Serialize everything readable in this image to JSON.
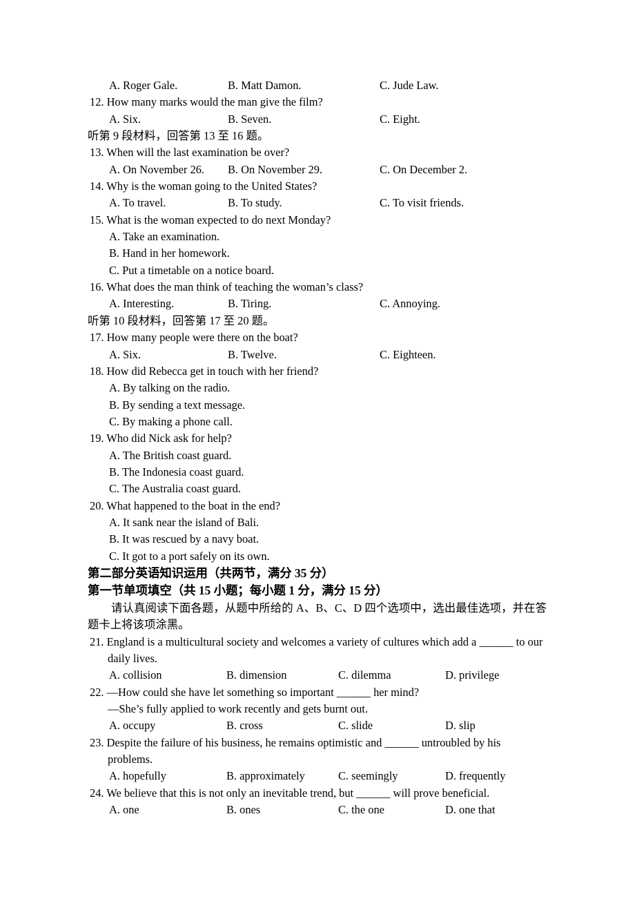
{
  "document": {
    "type": "exam-paper",
    "language": "zh-CN / en",
    "subject": "English"
  },
  "listening": {
    "q11_options": {
      "a": "A. Roger Gale.",
      "b": "B. Matt Damon.",
      "c": "C. Jude Law."
    },
    "q12": {
      "stem": "12. How many marks would the man give the film?",
      "a": "A. Six.",
      "b": "B. Seven.",
      "c": "C. Eight."
    },
    "material9_note": "听第 9 段材料，回答第 13 至 16 题。",
    "q13": {
      "stem": "13. When will the last examination be over?",
      "a": "A. On November 26.",
      "b": "B. On November 29.",
      "c": "C. On December 2."
    },
    "q14": {
      "stem": "14. Why is the woman going to the United States?",
      "a": "A. To travel.",
      "b": "B. To study.",
      "c": "C. To visit friends."
    },
    "q15": {
      "stem": "15. What is the woman expected to do next Monday?",
      "a": "A. Take an examination.",
      "b": "B. Hand in her homework.",
      "c": "C. Put a timetable on a notice board."
    },
    "q16": {
      "stem": "16. What does the man think of teaching the woman’s class?",
      "a": "A. Interesting.",
      "b": "B. Tiring.",
      "c": "C. Annoying."
    },
    "material10_note": "听第 10 段材料，回答第 17 至 20 题。",
    "q17": {
      "stem": "17. How many people were there on the boat?",
      "a": "A. Six.",
      "b": "B. Twelve.",
      "c": "C. Eighteen."
    },
    "q18": {
      "stem": "18. How did Rebecca get in touch with her friend?",
      "a": "A. By talking on the radio.",
      "b": "B. By sending a text message.",
      "c": "C. By making a phone call."
    },
    "q19": {
      "stem": "19. Who did Nick ask for help?",
      "a": "A. The British coast guard.",
      "b": "B. The Indonesia coast guard.",
      "c": "C. The Australia coast guard."
    },
    "q20": {
      "stem": "20. What happened to the boat in the end?",
      "a": "A. It sank near the island of Bali.",
      "b": "B. It was rescued by a navy boat.",
      "c": "C. It got to a port safely on its own."
    }
  },
  "part_two": {
    "heading": "第二部分英语知识运用（共两节，满分 35 分）",
    "section_one_heading": "第一节单项填空（共 15 小题；每小题 1 分，满分 15 分）",
    "instruction": "请认真阅读下面各题，从题中所给的 A、B、C、D 四个选项中，选出最佳选项，并在答题卡上将该项涂黑。",
    "q21": {
      "stem_line1": "21. England is a multicultural society and welcomes a variety of cultures which add a ______ to our",
      "stem_line2": "daily lives.",
      "a": "A. collision",
      "b": "B. dimension",
      "c": "C. dilemma",
      "d": "D. privilege"
    },
    "q22": {
      "stem_line1": "22. —How could she have let something so important ______ her mind?",
      "stem_line2": "—She’s fully applied to work recently and gets burnt out.",
      "a": "A. occupy",
      "b": "B. cross",
      "c": "C. slide",
      "d": "D. slip"
    },
    "q23": {
      "stem_line1": "23. Despite the failure of his business, he remains optimistic and ______ untroubled by his",
      "stem_line2": "problems.",
      "a": "A. hopefully",
      "b": "B. approximately",
      "c": "C. seemingly",
      "d": "D. frequently"
    },
    "q24": {
      "stem_line1": "24. We believe that this is not only an inevitable trend, but ______ will prove beneficial.",
      "a": "A. one",
      "b": "B. ones",
      "c": "C. the one",
      "d": "D. one that"
    }
  }
}
